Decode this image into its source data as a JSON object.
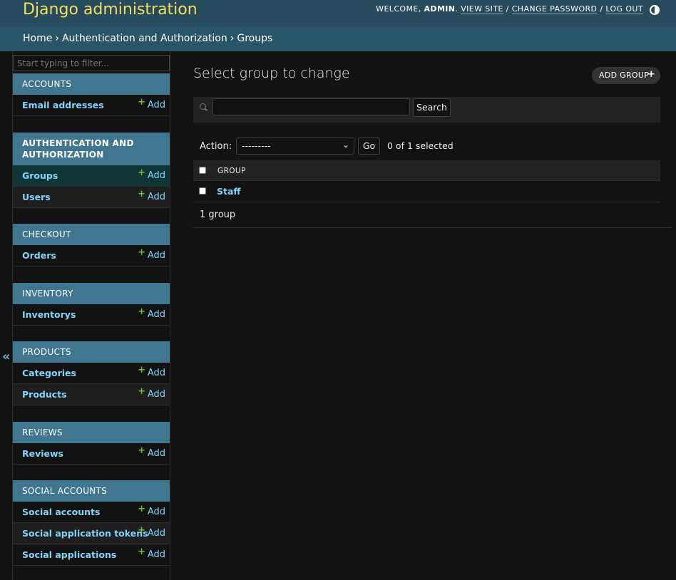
{
  "header": {
    "branding": "Django administration",
    "welcome": "WELCOME, ",
    "username": "ADMIN",
    "view_site": "VIEW SITE",
    "change_password": "CHANGE PASSWORD",
    "log_out": "LOG OUT",
    "separator": " / ",
    "theme_icon": "theme-toggle-icon"
  },
  "breadcrumbs": {
    "home": "Home",
    "section": "Authentication and Authorization",
    "current": "Groups",
    "separator": "›"
  },
  "sidebar": {
    "collapse_icon": "«",
    "filter_placeholder": "Start typing to filter...",
    "add_label": "Add",
    "plus": "+",
    "modules": [
      {
        "caption": "ACCOUNTS",
        "items": [
          "Email addresses"
        ]
      },
      {
        "caption": "AUTHENTICATION AND AUTHORIZATION",
        "items": [
          "Groups",
          "Users"
        ]
      },
      {
        "caption": "CHECKOUT",
        "items": [
          "Orders"
        ]
      },
      {
        "caption": "INVENTORY",
        "items": [
          "Inventorys"
        ]
      },
      {
        "caption": "PRODUCTS",
        "items": [
          "Categories",
          "Products"
        ]
      },
      {
        "caption": "REVIEWS",
        "items": [
          "Reviews"
        ]
      },
      {
        "caption": "SOCIAL ACCOUNTS",
        "items": [
          "Social accounts",
          "Social application tokens",
          "Social applications"
        ]
      }
    ]
  },
  "main": {
    "title": "Select group to change",
    "add_button": "ADD GROUP",
    "add_plus": "+",
    "search_value": "",
    "search_button": "Search",
    "action_label": "Action:",
    "action_selected": "---------",
    "go_button": "Go",
    "selection_counter": "0 of 1 selected",
    "column_header": "GROUP",
    "rows": [
      "Staff"
    ],
    "paginator": "1 group"
  },
  "colors": {
    "header_bg": "#264b5d",
    "branding": "#f5dd5d",
    "module_caption": "#417690",
    "link": "#81d4fa",
    "add_plus": "#70bf2b",
    "active_row": "#0f3535"
  }
}
